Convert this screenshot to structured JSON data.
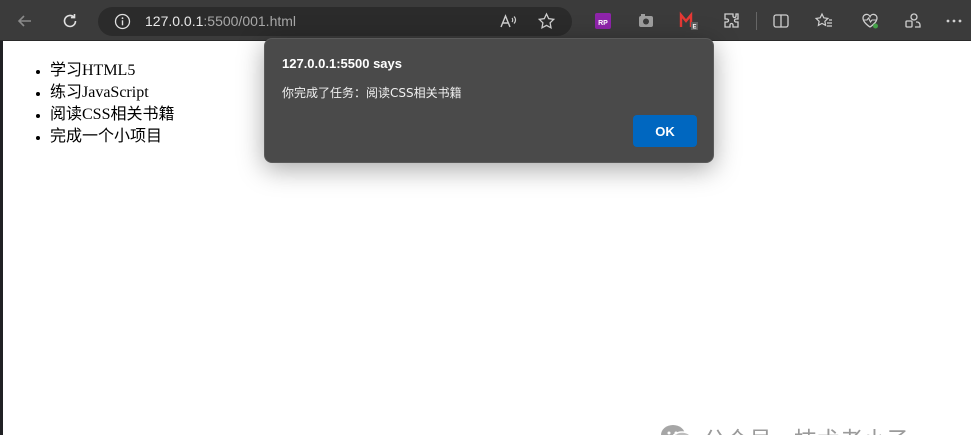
{
  "browser": {
    "url_host": "127.0.0.1",
    "url_rest": ":5500/001.html",
    "ext_rp_label": "RP",
    "ext_e_label": "E"
  },
  "page": {
    "todo_items": [
      "学习HTML5",
      "练习JavaScript",
      "阅读CSS相关书籍",
      "完成一个小项目"
    ]
  },
  "dialog": {
    "title": "127.0.0.1:5500 says",
    "message": "你完成了任务：阅读CSS相关书籍",
    "ok_label": "OK"
  },
  "watermark": {
    "text": "公众号 · 技术老小子"
  },
  "colors": {
    "toolbar": "#3b3b3b",
    "dialog_bg": "#4a4a4a",
    "accent": "#0067c0"
  }
}
